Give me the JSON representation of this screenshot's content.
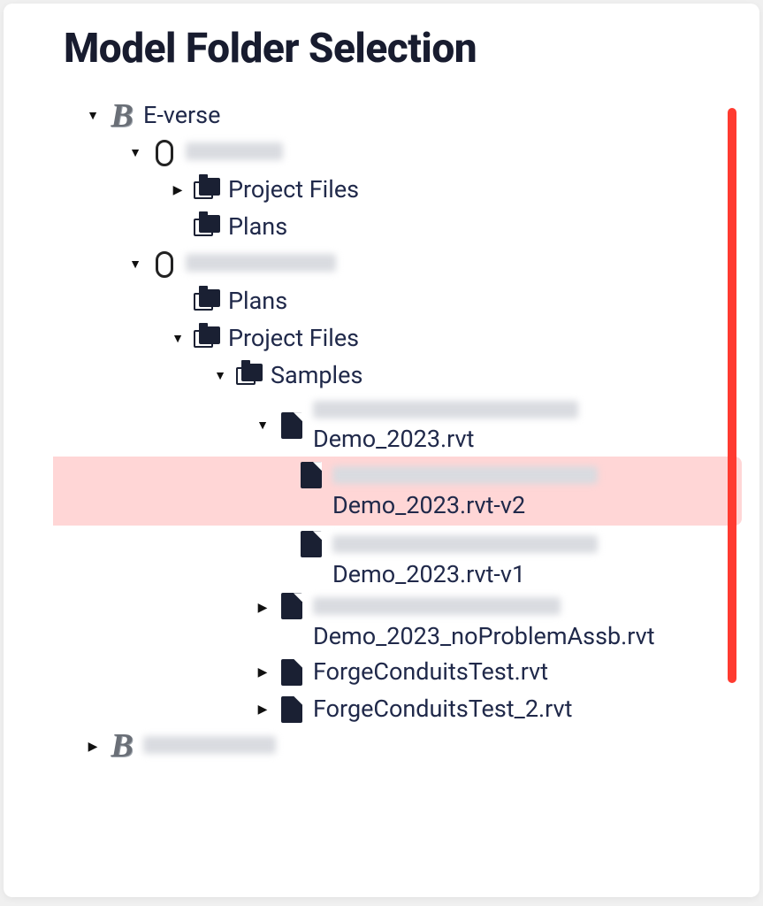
{
  "title": "Model Folder Selection",
  "tree": {
    "hub1": {
      "label": "E-verse",
      "redactedChild1": ""
    },
    "proj1": {
      "blurLabelWidth": 110,
      "folders": {
        "f1": "Project Files",
        "f2": "Plans"
      }
    },
    "proj2": {
      "blurLabelWidth": 170,
      "folders": {
        "f1": "Plans",
        "f2": "Project Files",
        "samples": "Samples"
      }
    },
    "files": {
      "file1_blurWidth": 300,
      "file1_name": "Demo_2023.rvt",
      "file1_v2_blurWidth": 300,
      "file1_v2_name": "Demo_2023.rvt-v2",
      "file1_v1_blurWidth": 300,
      "file1_v1_name": "Demo_2023.rvt-v1",
      "file2_blurWidth": 280,
      "file2_name": "Demo_2023_noProblemAssb.rvt",
      "file3_name": "ForgeConduitsTest.rvt",
      "file4_name": "ForgeConduitsTest_2.rvt"
    },
    "hub2_blurWidth": 150
  },
  "colors": {
    "selection": "#ffd6d6",
    "scroll": "#ff3b30",
    "text": "#20294a"
  }
}
